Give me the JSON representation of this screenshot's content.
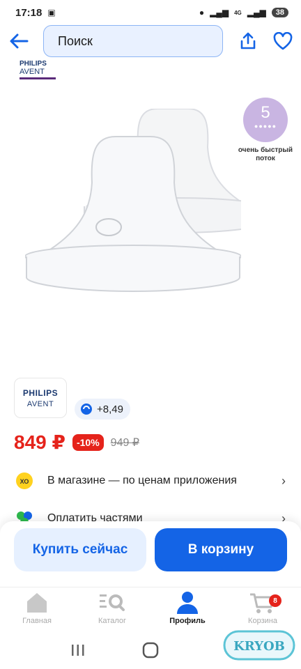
{
  "status_bar": {
    "time": "17:18",
    "network": "4G",
    "battery": "38"
  },
  "header": {
    "search_placeholder": "Поиск"
  },
  "product": {
    "brand_top": {
      "line1": "PHILIPS",
      "line2": "AVENT"
    },
    "flow_badge": {
      "number": "5",
      "caption": "очень быстрый поток"
    },
    "brand_card": {
      "line1": "PHILIPS",
      "line2": "AVENT"
    },
    "bonus": "+8,49",
    "price": {
      "current": "849 ₽",
      "discount": "-10%",
      "old": "949 ₽"
    },
    "rows": [
      {
        "label": "В магазине — по ценам приложения",
        "icon": "hochu-icon"
      },
      {
        "label": "Оплатить частями",
        "icon": "split-payment-icon"
      }
    ]
  },
  "actions": {
    "buy_now": "Купить сейчас",
    "to_cart": "В корзину"
  },
  "bottom_nav": {
    "items": [
      {
        "label": "Главная",
        "icon": "home-icon"
      },
      {
        "label": "Каталог",
        "icon": "catalog-search-icon"
      },
      {
        "label": "Профиль",
        "icon": "profile-icon",
        "active": true
      },
      {
        "label": "Корзина",
        "icon": "cart-icon",
        "badge": "8"
      }
    ]
  },
  "watermark": "KRYOB",
  "colors": {
    "accent": "#1464e6",
    "price": "#e5231b",
    "badge": "#c9b5e2"
  }
}
